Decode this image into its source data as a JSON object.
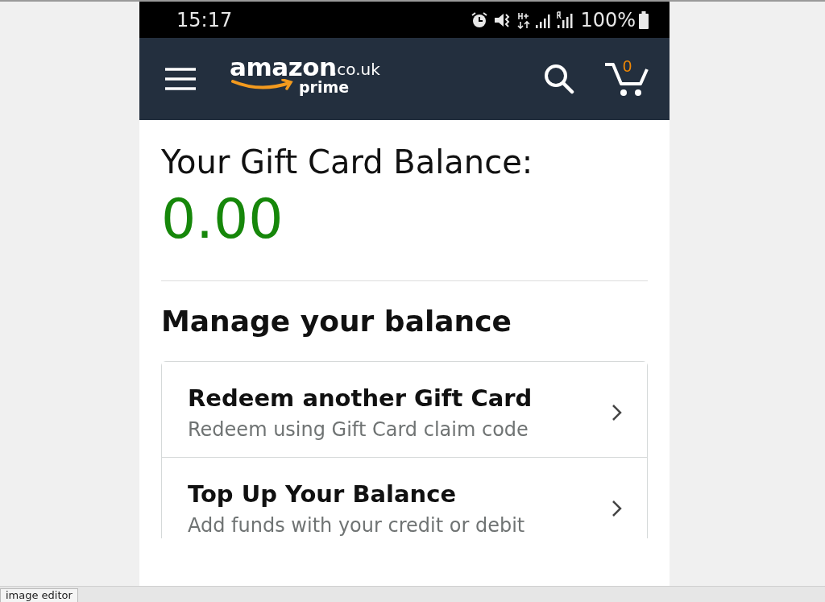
{
  "status_bar": {
    "time": "15:17",
    "battery": "100%"
  },
  "header": {
    "logo": {
      "brand": "amazon",
      "domain": ".co.uk",
      "tier": "prime"
    },
    "cart_count": "0"
  },
  "balance": {
    "title": "Your Gift Card Balance:",
    "amount": "0.00"
  },
  "manage": {
    "title": "Manage your balance",
    "options": [
      {
        "title": "Redeem another Gift Card",
        "subtitle": "Redeem using Gift Card claim code"
      },
      {
        "title": "Top Up Your Balance",
        "subtitle": "Add funds with your credit or debit"
      }
    ]
  },
  "taskbar": {
    "tab": "image editor"
  }
}
